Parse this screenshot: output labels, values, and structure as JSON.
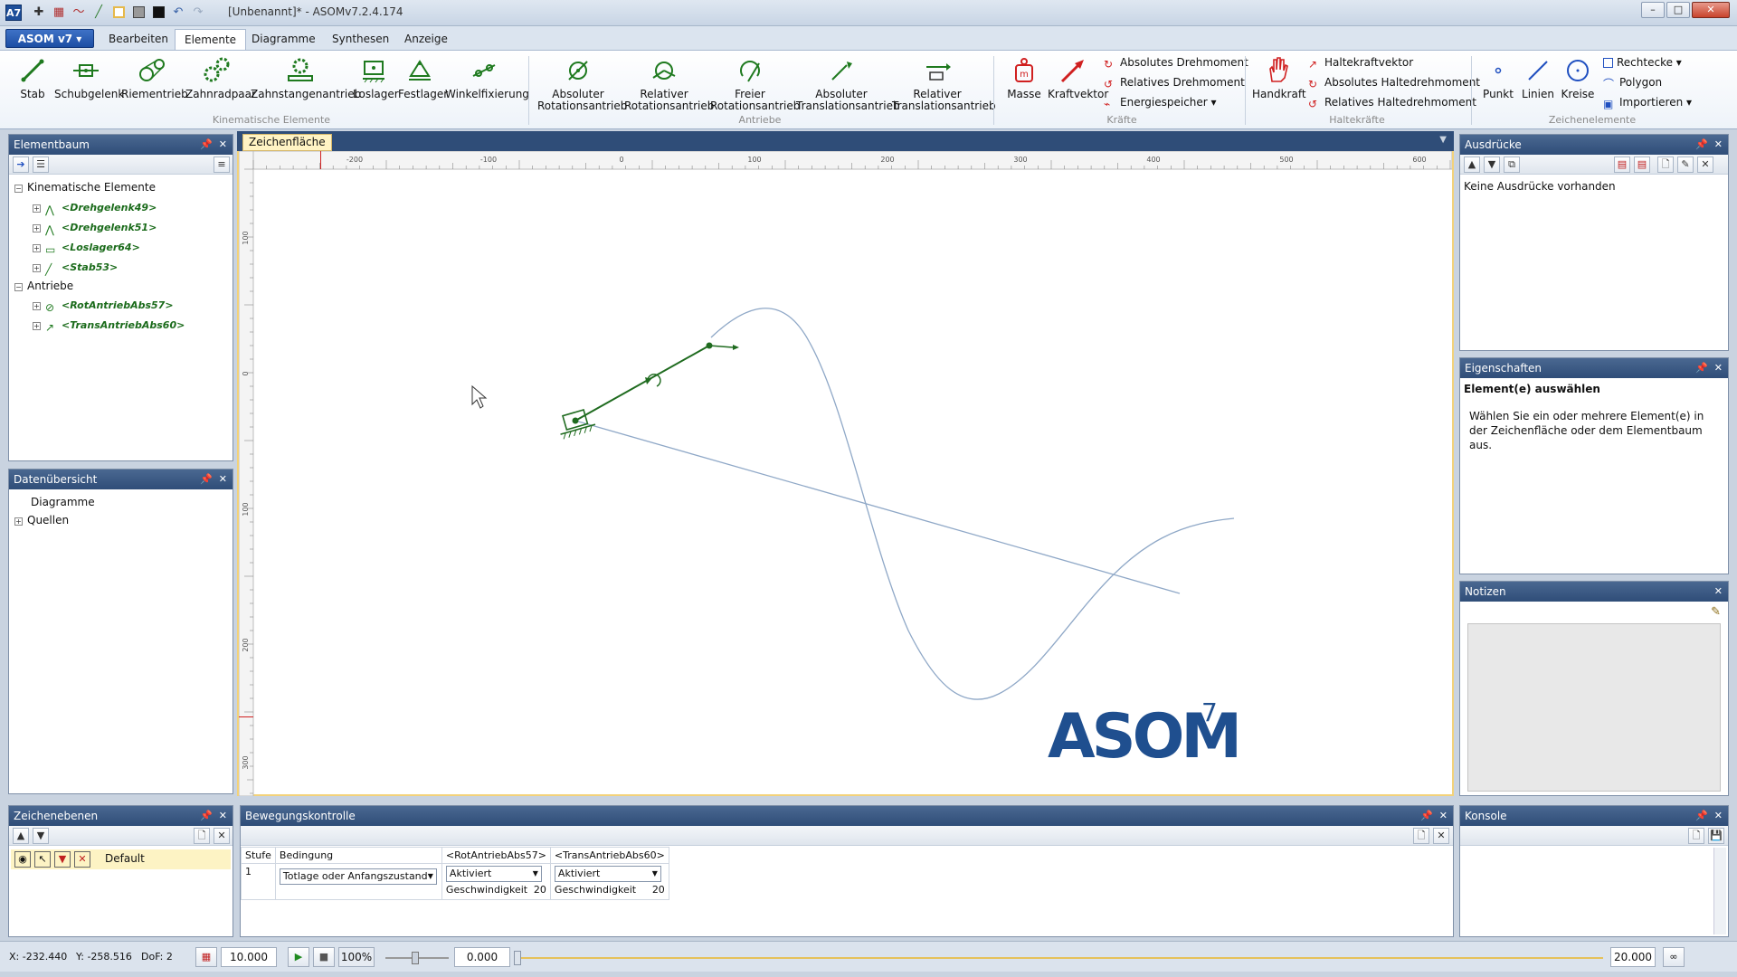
{
  "titlebar": {
    "app_icon": "A7",
    "title": "[Unbenannt]* - ASOMv7.2.4.174",
    "qat_icons": [
      "crosshair-icon",
      "grid-icon",
      "curve-icon",
      "line-icon",
      "color-white-icon",
      "color-gray-icon",
      "color-black-icon",
      "undo-icon",
      "redo-icon"
    ],
    "buttons": [
      "–",
      "□",
      "✕"
    ]
  },
  "ribbon_tabs": {
    "app_menu": "ASOM v7 ▾",
    "tabs": [
      "Bearbeiten",
      "Elemente",
      "Diagramme",
      "Synthesen",
      "Anzeige"
    ],
    "active": "Elemente"
  },
  "ribbon": {
    "kinematic": {
      "label": "Kinematische Elemente",
      "items": [
        "Stab",
        "Schubgelenk",
        "Riementrieb",
        "Zahnradpaar",
        "Zahnstangenantrieb",
        "Loslager",
        "Festlager",
        "Winkelfixierung"
      ]
    },
    "drives": {
      "label": "Antriebe",
      "items": [
        "Absoluter Rotationsantrieb",
        "Relativer Rotationsantrieb",
        "Freier Rotationsantrieb",
        "Absoluter Translationsantrieb",
        "Relativer Translationsantrieb"
      ]
    },
    "forces": {
      "label": "Kräfte",
      "items": [
        "Masse",
        "Kraftvektor"
      ],
      "small": [
        "Absolutes Drehmoment",
        "Relatives Drehmoment",
        "Energiespeicher ▾"
      ]
    },
    "holding": {
      "label": "Haltekräfte",
      "items": [
        "Handkraft"
      ],
      "small": [
        "Haltekraftvektor",
        "Absolutes Haltedrehmoment",
        "Relatives Haltedrehmoment"
      ]
    },
    "drawing": {
      "label": "Zeichenelemente",
      "items": [
        "Punkt",
        "Linien",
        "Kreise"
      ],
      "small": [
        "Rechtecke ▾",
        "Polygon",
        "Importieren ▾"
      ]
    }
  },
  "elementbaum": {
    "title": "Elementbaum",
    "groups": [
      {
        "label": "Kinematische Elemente",
        "items": [
          "<Drehgelenk49>",
          "<Drehgelenk51>",
          "<Loslager64>",
          "<Stab53>"
        ]
      },
      {
        "label": "Antriebe",
        "items": [
          "<RotAntriebAbs57>",
          "<TransAntriebAbs60>"
        ]
      }
    ]
  },
  "datenuebersicht": {
    "title": "Datenübersicht",
    "items": [
      "Diagramme",
      "Quellen"
    ]
  },
  "zeichenebenen": {
    "title": "Zeichenebenen",
    "layer": "Default"
  },
  "canvas": {
    "tab": "Zeichenfläche",
    "ruler_top": [
      "-200",
      "-100",
      "0",
      "100",
      "200",
      "300",
      "400",
      "500",
      "600"
    ],
    "ruler_left": [
      "100",
      "0",
      "100",
      "200",
      "300"
    ],
    "logo": "ASOM",
    "logo_sup": "7",
    "colors": {
      "mechanism": "#1f6b1f",
      "curve": "#8fa8c7",
      "logo": "#1f4f8f"
    }
  },
  "ausdruecke": {
    "title": "Ausdrücke",
    "text": "Keine Ausdrücke vorhanden"
  },
  "eigenschaften": {
    "title": "Eigenschaften",
    "heading": "Element(e) auswählen",
    "text": "Wählen Sie ein oder mehrere Element(e) in der Zeichenfläche oder dem Elementbaum aus."
  },
  "notizen": {
    "title": "Notizen"
  },
  "bewegungskontrolle": {
    "title": "Bewegungskontrolle",
    "headers": [
      "Stufe",
      "Bedingung",
      "<RotAntriebAbs57>",
      "<TransAntriebAbs60>"
    ],
    "row": {
      "stufe": "1",
      "bedingung": "Totlage oder Anfangszustand",
      "rot_state": "Aktiviert",
      "trans_state": "Aktiviert",
      "speed_label": "Geschwindigkeit",
      "rot_speed": "20",
      "trans_speed": "20"
    }
  },
  "konsole": {
    "title": "Konsole"
  },
  "statusbar": {
    "x": "X: -232.440",
    "y": "Y: -258.516",
    "dof": "DoF: 2",
    "grid_value": "10.000",
    "zoom": "100%",
    "time": "0.000",
    "end_time": "20.000"
  }
}
